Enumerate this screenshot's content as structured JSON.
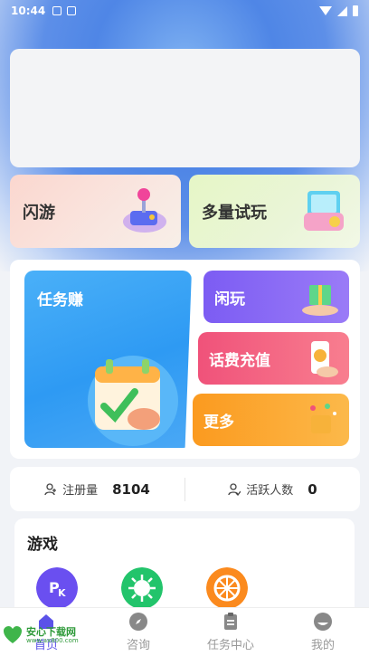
{
  "status_bar": {
    "time": "10:44"
  },
  "quick_cards": [
    {
      "label": "闪游"
    },
    {
      "label": "多量试玩"
    }
  ],
  "tasks": {
    "main_label": "任务赚",
    "side": [
      {
        "label": "闲玩"
      },
      {
        "label": "话费充值"
      },
      {
        "label": "更多"
      }
    ]
  },
  "stats": {
    "registered_label": "注册量",
    "registered_value": "8104",
    "active_label": "活跃人数",
    "active_value": "0"
  },
  "games": {
    "title": "游戏",
    "icons": [
      {
        "name": "pk-game-icon",
        "color": "#6a4ff0"
      },
      {
        "name": "virus-game-icon",
        "color": "#22c46b"
      },
      {
        "name": "wheel-game-icon",
        "color": "#fb8a1e"
      }
    ]
  },
  "tabbar": {
    "items": [
      {
        "label": "首页"
      },
      {
        "label": "咨询"
      },
      {
        "label": "任务中心"
      },
      {
        "label": "我的"
      }
    ]
  },
  "watermark": {
    "text": "安心下载网",
    "url": "www.ax800.com"
  },
  "colors": {
    "accent": "#3a8bf0"
  }
}
